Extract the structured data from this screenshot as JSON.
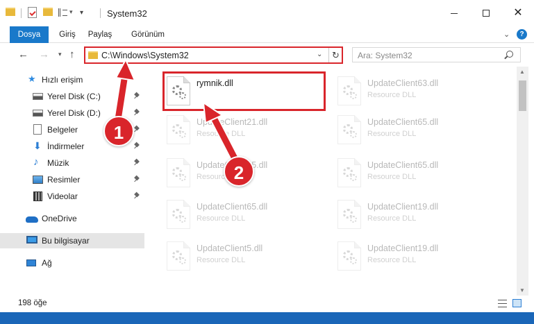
{
  "window": {
    "title": "System32",
    "qa_more": "▾",
    "minimize_glyph": "",
    "maximize_glyph": "",
    "close_glyph": "✕"
  },
  "ribbon": {
    "tabs": [
      "Dosya",
      "Giriş",
      "Paylaş",
      "Görünüm"
    ],
    "help": "?"
  },
  "address": {
    "path": "C:\\Windows\\System32",
    "search_placeholder": "Ara: System32"
  },
  "nav_pane": {
    "items": [
      {
        "label": "Hızlı erişim",
        "icon": "star-icon"
      },
      {
        "label": "Yerel Disk (C:)",
        "icon": "disk-icon",
        "pinned": true
      },
      {
        "label": "Yerel Disk (D:)",
        "icon": "disk-icon",
        "pinned": true
      },
      {
        "label": "Belgeler",
        "icon": "document-icon",
        "pinned": true
      },
      {
        "label": "İndirmeler",
        "icon": "download-icon",
        "pinned": true
      },
      {
        "label": "Müzik",
        "icon": "music-icon",
        "pinned": true
      },
      {
        "label": "Resimler",
        "icon": "pictures-icon",
        "pinned": true
      },
      {
        "label": "Videolar",
        "icon": "video-icon",
        "pinned": true
      },
      {
        "label": "OneDrive",
        "icon": "cloud-icon"
      },
      {
        "label": "Bu bilgisayar",
        "icon": "computer-icon",
        "selected": true
      },
      {
        "label": "Ağ",
        "icon": "network-icon"
      }
    ]
  },
  "files": [
    {
      "name": "rymnik.dll",
      "type": "",
      "highlighted": true
    },
    {
      "name": "UpdateClient63.dll",
      "type": "Resource DLL"
    },
    {
      "name": "UpdateClient21.dll",
      "type": "Resource DLL"
    },
    {
      "name": "UpdateClient65.dll",
      "type": "Resource DLL"
    },
    {
      "name": "UpdateClient65.dll",
      "type": "Resource DLL"
    },
    {
      "name": "UpdateClient65.dll",
      "type": "Resource DLL"
    },
    {
      "name": "UpdateClient65.dll",
      "type": "Resource DLL"
    },
    {
      "name": "UpdateClient19.dll",
      "type": "Resource DLL"
    },
    {
      "name": "UpdateClient5.dll",
      "type": "Resource DLL"
    },
    {
      "name": "UpdateClient19.dll",
      "type": "Resource DLL"
    }
  ],
  "status": {
    "count": "198 öğe"
  },
  "annotations": {
    "callout_1": "1",
    "callout_2": "2",
    "color": "#d9252b"
  }
}
